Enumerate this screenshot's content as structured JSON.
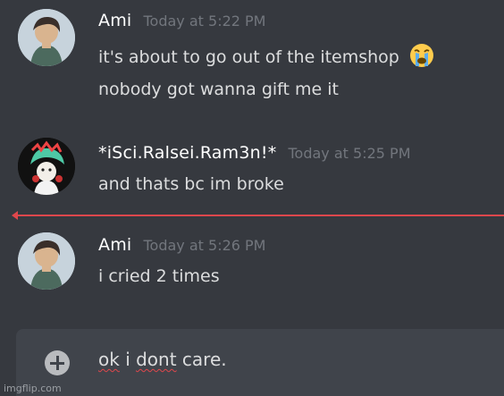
{
  "messages": [
    {
      "author": "Ami",
      "timestamp": "Today at 5:22 PM",
      "lines": [
        "it's about to go out of the itemshop",
        "nobody got wanna gift me it"
      ],
      "emoji": "loudly-crying-face"
    },
    {
      "author": "*iSci.Ralsei.Ram3n!*",
      "timestamp": "Today at 5:25 PM",
      "lines": [
        "and thats bc im broke"
      ]
    },
    {
      "author": "Ami",
      "timestamp": "Today at 5:26 PM",
      "lines": [
        "i cried 2 times"
      ]
    }
  ],
  "composer": {
    "words": [
      "ok",
      " ",
      "i",
      " ",
      "dont",
      " care."
    ]
  },
  "watermark": "imgflip.com",
  "colors": {
    "background": "#36393f",
    "composer": "#40444b",
    "new_divider": "#e0474c",
    "timestamp": "#72767d",
    "message_text": "#dcddde"
  },
  "icons": {
    "emoji": "loudly-crying-face-icon",
    "add": "plus-circle-icon"
  }
}
